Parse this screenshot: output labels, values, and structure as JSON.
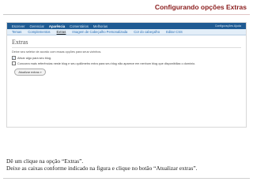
{
  "slide": {
    "title": "Configurando opções Extras"
  },
  "app": {
    "menu": [
      "Escrever",
      "Gerenciar",
      "Aparência",
      "Comentários",
      "Melhorias"
    ],
    "active_menu": "Aparência",
    "menu_right": "Configurações   Ajuda",
    "submenu": [
      "Temas",
      "Complementos",
      "Extras",
      "Imagem de Cabeçalho Personalizada",
      "Cor do cabeçalho",
      "Editar CSS"
    ],
    "active_submenu": "Extras",
    "page_heading": "Extras",
    "intro_text": "Deixe seu seletor de acordo com essas opções para seus vizinhos.",
    "options": [
      {
        "label": "Ativar algo para seu blog.",
        "checked": true
      },
      {
        "label": "Concorra mais referências neste blog e seu quilômetro extra para seu blog não aparece em nenhum blog que disponibiliza o domínio.",
        "checked": false
      }
    ],
    "update_button": "Atualizar extras »"
  },
  "instructions": {
    "line1": "Dê um clique na opção “Extras”.",
    "line2": "Deixe as caixas conforme indicado na figura e clique no botão “Atualizar extras”."
  },
  "colors": {
    "title": "#8a1c1c",
    "menu_bar": "#1f5b93",
    "submenu_bar": "#e3eef8",
    "link": "#2a6fb6"
  }
}
